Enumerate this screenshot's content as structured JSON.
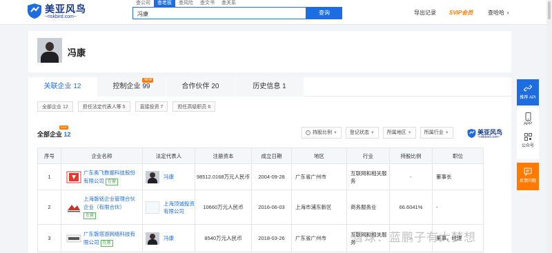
{
  "header": {
    "brand_name": "美亚风鸟",
    "brand_domain": "~riskbird.com~",
    "search_tabs": [
      "查公司",
      "查老板",
      "查风险",
      "查文书",
      "查关系"
    ],
    "active_tab_index": 1,
    "search_value": "冯康",
    "search_button": "查询",
    "export_label": "导出记录",
    "svip_label": "SVIP会员",
    "user_label": "查哈哈"
  },
  "person": {
    "name": "冯康"
  },
  "tabs": [
    {
      "label": "关联企业 12"
    },
    {
      "label": "控制企业 99",
      "badge": "NEW"
    },
    {
      "label": "合作伙伴 20"
    },
    {
      "label": "历史信息 1"
    }
  ],
  "chips": [
    "全部企业 12",
    "担任法定代表人等 5",
    "直接投资 7",
    "担任高级职员 6"
  ],
  "section": {
    "title": "全部企业",
    "count": "12",
    "badge": "SVIP"
  },
  "filters": [
    "持股比例",
    "登记状态",
    "所属地区",
    "所属行业"
  ],
  "table": {
    "columns": [
      "序号",
      "企业名称",
      "法定代表人",
      "注册资本",
      "成立日期",
      "地区",
      "行业",
      "持股比例",
      "职位"
    ],
    "rows": [
      {
        "index": "1",
        "company": "广东奥飞数据科技股份有限公司",
        "status": "在营",
        "rep": "冯康",
        "capital": "98512.0168万元人民币",
        "date": "2004-09-28",
        "region": "广东省广州市",
        "industry": "互联网和相关服务",
        "share": "-",
        "position": "董事长"
      },
      {
        "index": "2",
        "company": "上海磐铭企业管理合伙企业（有限合伙）",
        "status": "在营",
        "rep": "上海顶诚投资有限公司",
        "capital": "10660万元人民币",
        "date": "2016-06-03",
        "region": "上海市浦东新区",
        "industry": "商务服务业",
        "share": "66.6041%",
        "position": "-"
      },
      {
        "index": "3",
        "company": "广东磐塔游网络科技有限公司",
        "status": "在营",
        "rep": "冯康",
        "capital": "8540万元人民币",
        "date": "2018-03-26",
        "region": "广东省广州市",
        "industry": "互联网和相关服务",
        "share": "-",
        "position": "董事，经理"
      }
    ]
  },
  "sidebar": {
    "api_label": "推荐 API",
    "app_label": "APP",
    "wechat_label": "公众号",
    "feedback_label": "反馈问题"
  },
  "watermark": "雪球：蓝鹏子有大梦想",
  "colors": {
    "primary": "#1e6de0",
    "accent": "#ff7a00",
    "status_green": "#4a9e4a"
  }
}
